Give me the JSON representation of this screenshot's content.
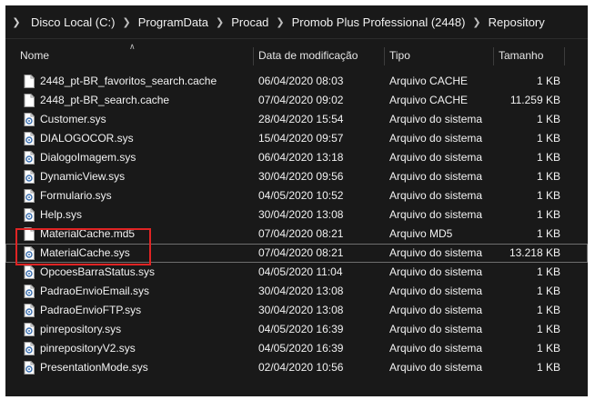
{
  "breadcrumb": [
    "Disco Local (C:)",
    "ProgramData",
    "Procad",
    "Promob Plus Professional (2448)",
    "Repository"
  ],
  "columns": {
    "name": "Nome",
    "date": "Data de modificação",
    "type": "Tipo",
    "size": "Tamanho"
  },
  "files": [
    {
      "name": "2448_pt-BR_favoritos_search.cache",
      "date": "06/04/2020 08:03",
      "type": "Arquivo CACHE",
      "size": "1 KB",
      "icon": "document-icon"
    },
    {
      "name": "2448_pt-BR_search.cache",
      "date": "07/04/2020 09:02",
      "type": "Arquivo CACHE",
      "size": "11.259 KB",
      "icon": "document-icon"
    },
    {
      "name": "Customer.sys",
      "date": "28/04/2020 15:54",
      "type": "Arquivo do sistema",
      "size": "1 KB",
      "icon": "system-file-icon"
    },
    {
      "name": "DIALOGOCOR.sys",
      "date": "15/04/2020 09:57",
      "type": "Arquivo do sistema",
      "size": "1 KB",
      "icon": "system-file-icon"
    },
    {
      "name": "DialogoImagem.sys",
      "date": "06/04/2020 13:18",
      "type": "Arquivo do sistema",
      "size": "1 KB",
      "icon": "system-file-icon"
    },
    {
      "name": "DynamicView.sys",
      "date": "30/04/2020 09:56",
      "type": "Arquivo do sistema",
      "size": "1 KB",
      "icon": "system-file-icon"
    },
    {
      "name": "Formulario.sys",
      "date": "04/05/2020 10:52",
      "type": "Arquivo do sistema",
      "size": "1 KB",
      "icon": "system-file-icon"
    },
    {
      "name": "Help.sys",
      "date": "30/04/2020 13:08",
      "type": "Arquivo do sistema",
      "size": "1 KB",
      "icon": "system-file-icon"
    },
    {
      "name": "MaterialCache.md5",
      "date": "07/04/2020 08:21",
      "type": "Arquivo MD5",
      "size": "1 KB",
      "icon": "document-icon"
    },
    {
      "name": "MaterialCache.sys",
      "date": "07/04/2020 08:21",
      "type": "Arquivo do sistema",
      "size": "13.218 KB",
      "icon": "system-file-icon",
      "selected": true
    },
    {
      "name": "OpcoesBarraStatus.sys",
      "date": "04/05/2020 11:04",
      "type": "Arquivo do sistema",
      "size": "1 KB",
      "icon": "system-file-icon"
    },
    {
      "name": "PadraoEnvioEmail.sys",
      "date": "30/04/2020 13:08",
      "type": "Arquivo do sistema",
      "size": "1 KB",
      "icon": "system-file-icon"
    },
    {
      "name": "PadraoEnvioFTP.sys",
      "date": "30/04/2020 13:08",
      "type": "Arquivo do sistema",
      "size": "1 KB",
      "icon": "system-file-icon"
    },
    {
      "name": "pinrepository.sys",
      "date": "04/05/2020 16:39",
      "type": "Arquivo do sistema",
      "size": "1 KB",
      "icon": "system-file-icon"
    },
    {
      "name": "pinrepositoryV2.sys",
      "date": "04/05/2020 16:39",
      "type": "Arquivo do sistema",
      "size": "1 KB",
      "icon": "system-file-icon"
    },
    {
      "name": "PresentationMode.sys",
      "date": "02/04/2020 10:56",
      "type": "Arquivo do sistema",
      "size": "1 KB",
      "icon": "system-file-icon"
    }
  ],
  "colors": {
    "background": "#191919",
    "highlight": "#e02424",
    "text": "#f2f2f2"
  }
}
